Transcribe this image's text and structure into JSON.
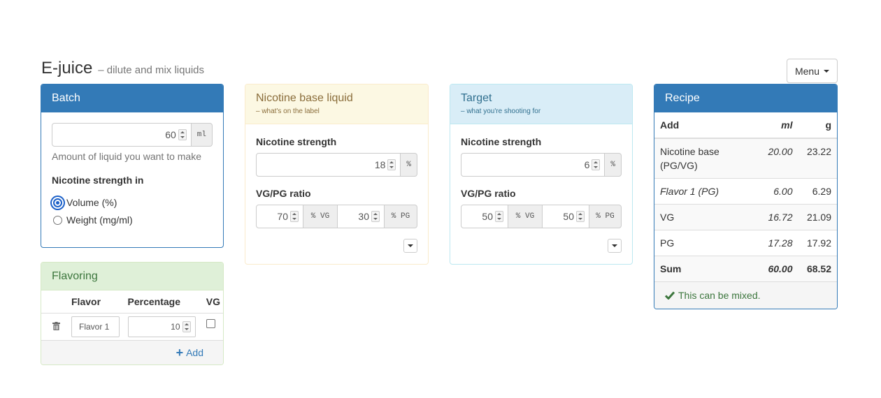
{
  "page": {
    "title": "E-juice",
    "subtitle": "– dilute and mix liquids",
    "menu_label": "Menu"
  },
  "batch": {
    "title": "Batch",
    "amount_value": "60",
    "amount_unit": "ml",
    "amount_help": "Amount of liquid you want to make",
    "strength_label": "Nicotine strength in",
    "options": [
      "Volume (%)",
      "Weight (mg/ml)"
    ],
    "selected_option": "Volume (%)"
  },
  "nicotine_base": {
    "title": "Nicotine base liquid",
    "subtitle": "– what's on the label",
    "strength_label": "Nicotine strength",
    "strength_value": "18",
    "strength_unit": "%",
    "ratio_label": "VG/PG ratio",
    "vg_value": "70",
    "vg_unit": "% VG",
    "pg_value": "30",
    "pg_unit": "% PG"
  },
  "target": {
    "title": "Target",
    "subtitle": "– what you're shooting for",
    "strength_label": "Nicotine strength",
    "strength_value": "6",
    "strength_unit": "%",
    "ratio_label": "VG/PG ratio",
    "vg_value": "50",
    "vg_unit": "% VG",
    "pg_value": "50",
    "pg_unit": "% PG"
  },
  "recipe": {
    "title": "Recipe",
    "headers": [
      "Add",
      "ml",
      "g"
    ],
    "rows": [
      {
        "name": "Nicotine base (PG/VG)",
        "ml": "20.00",
        "g": "23.22"
      },
      {
        "name": "Flavor 1 (PG)",
        "ml": "6.00",
        "g": "6.29"
      },
      {
        "name": "VG",
        "ml": "16.72",
        "g": "21.09"
      },
      {
        "name": "PG",
        "ml": "17.28",
        "g": "17.92"
      }
    ],
    "sum": {
      "name": "Sum",
      "ml": "60.00",
      "g": "68.52"
    },
    "status": "This can be mixed."
  },
  "flavoring": {
    "title": "Flavoring",
    "headers": [
      "Flavor",
      "Percentage",
      "VG"
    ],
    "rows": [
      {
        "name": "Flavor 1",
        "percentage": "10",
        "vg": false
      }
    ],
    "add_label": "Add"
  },
  "colors": {
    "primary": "#337ab7",
    "success_text": "#3c763d"
  }
}
